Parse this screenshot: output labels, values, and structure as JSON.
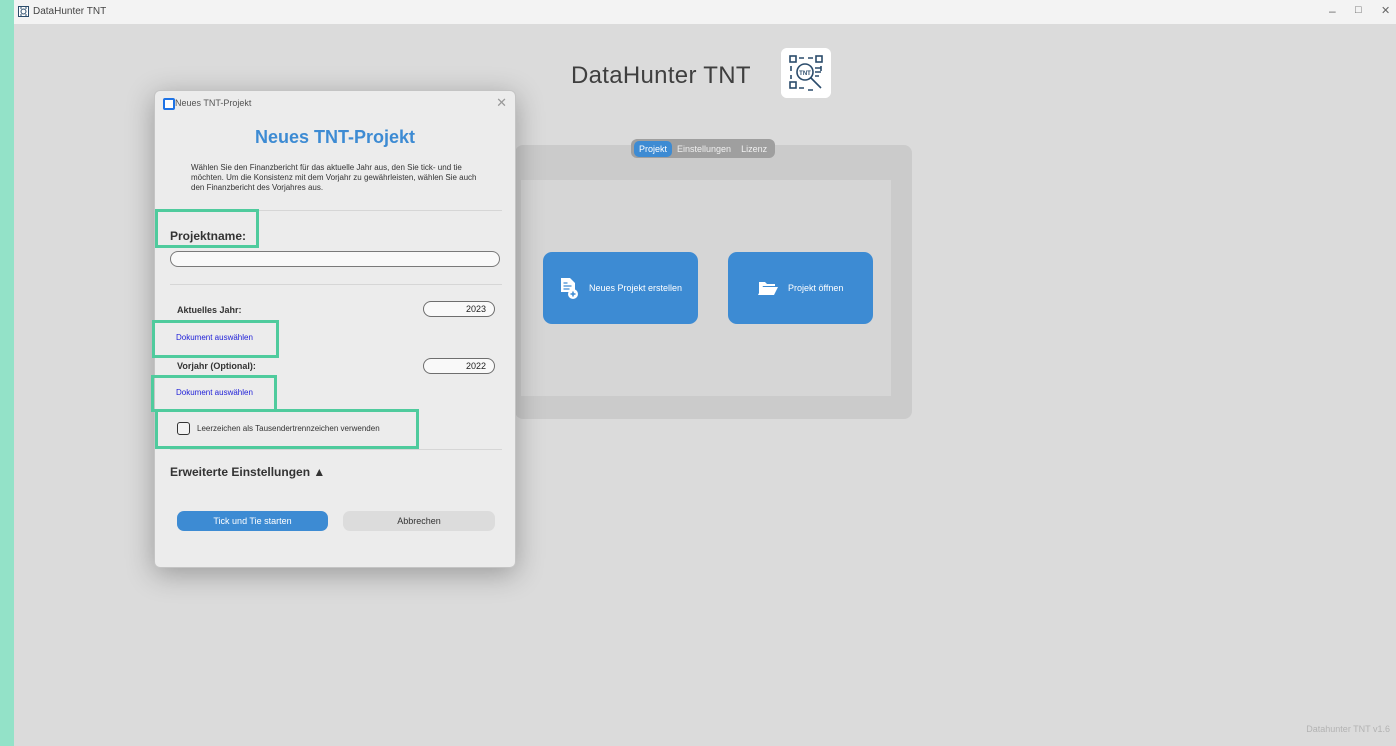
{
  "window": {
    "title": "DataHunter TNT",
    "controls": {
      "minimize": "–",
      "maximize": "□",
      "close": "✕"
    }
  },
  "app": {
    "title": "DataHunter TNT",
    "version": "Datahunter TNT v1.6",
    "accent_color": "#3d8bd3"
  },
  "tabs": [
    {
      "label": "Projekt",
      "active": true
    },
    {
      "label": "Einstellungen",
      "active": false
    },
    {
      "label": "Lizenz",
      "active": false
    }
  ],
  "actions": {
    "new_project": {
      "label": "Neues Projekt erstellen",
      "icon": "new-document-icon"
    },
    "open_project": {
      "label": "Projekt öffnen",
      "icon": "folder-open-icon"
    }
  },
  "dialog": {
    "window_title": "Neues TNT-Projekt",
    "heading": "Neues TNT-Projekt",
    "description": "Wählen Sie den Finanzbericht für das aktuelle Jahr aus, den Sie tick- und tie möchten. Um die Konsistenz mit dem Vorjahr zu gewährleisten, wählen Sie auch den Finanzbericht des Vorjahres aus.",
    "project_name_label": "Projektname:",
    "project_name_value": "",
    "current_year_label": "Aktuelles Jahr:",
    "current_year_value": "2023",
    "current_doc_link": "Dokument auswählen",
    "previous_year_label": "Vorjahr (Optional):",
    "previous_year_value": "2022",
    "previous_doc_link": "Dokument auswählen",
    "checkbox_label": "Leerzeichen als Tausendertrennzeichen verwenden",
    "checkbox_checked": false,
    "advanced_label": "Erweiterte Einstellungen ▲",
    "start_button": "Tick und Tie starten",
    "cancel_button": "Abbrechen",
    "highlight_color": "#4fcb9d"
  }
}
